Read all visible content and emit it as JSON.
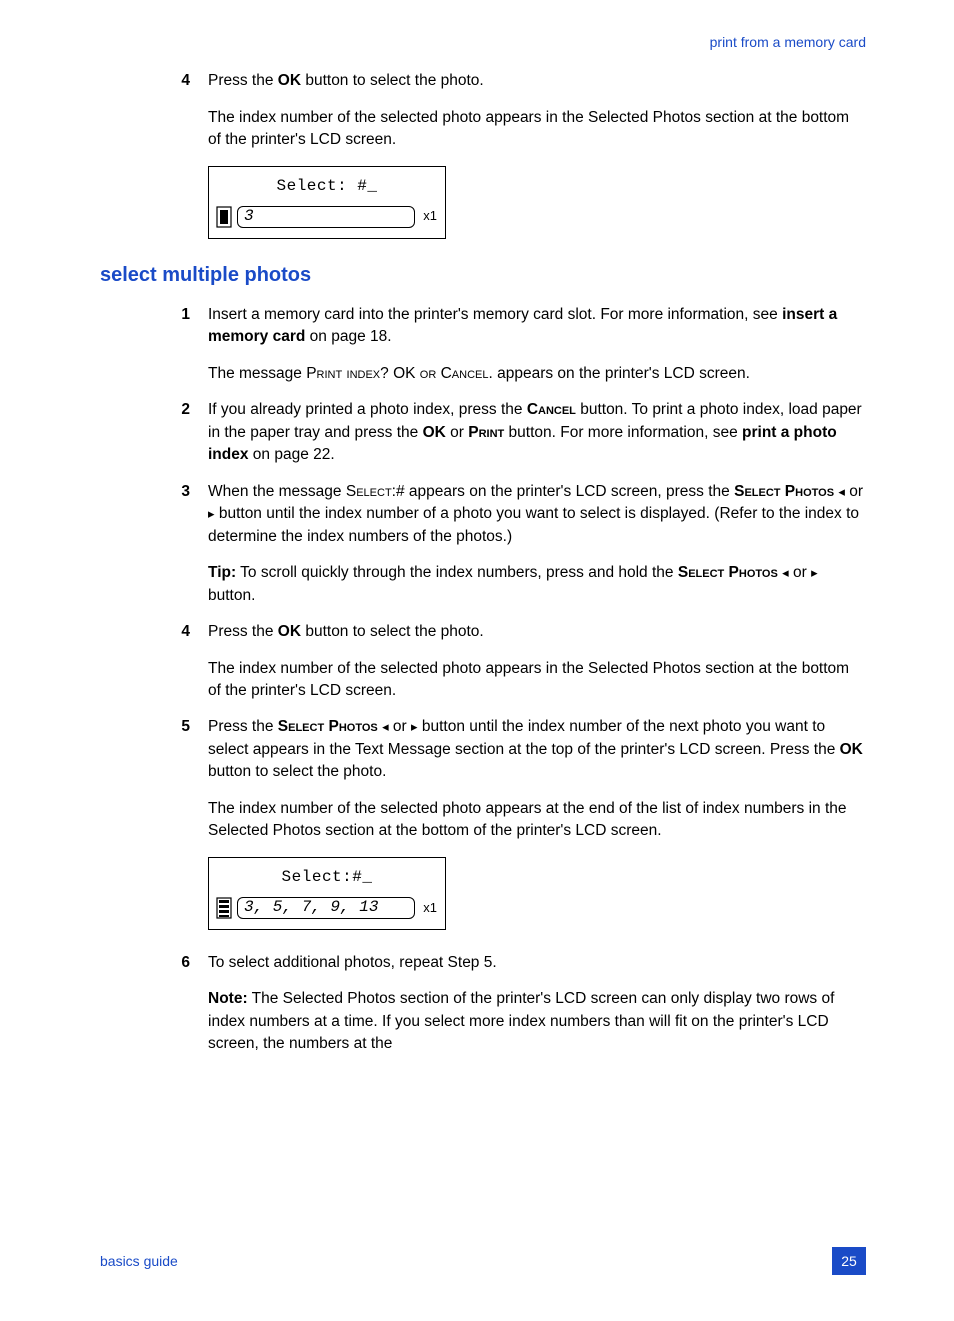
{
  "header": {
    "section": "print from a memory card"
  },
  "pre_steps": [
    {
      "num": "4",
      "paras": [
        "Press the <b>OK</b> button to select the photo.",
        "The index number of the selected photo appears in the Selected Photos section at the bottom of the printer's LCD screen."
      ]
    }
  ],
  "lcd1": {
    "top": "Select: #_",
    "sel": "3",
    "x": "x1"
  },
  "heading": "select multiple photos",
  "steps": [
    {
      "num": "1",
      "paras": [
        "Insert a memory card into the printer's memory card slot. For more information, see <b>insert a memory card</b> on page 18.",
        "The message <span class=\"sc\">Print index</span>? OK <span class=\"sc\">or</span> C<span class=\"sc\">ancel</span>. appears on the printer's LCD screen."
      ]
    },
    {
      "num": "2",
      "paras": [
        "If you already printed a photo index, press the <b>C<span class=\"sc\">ancel</span></b> button. To print a photo index, load paper in the paper tray and press the <b>OK</b> or <b>P<span class=\"sc\">rint</span></b> button. For more information, see <b>print a photo index</b> on page 22."
      ]
    },
    {
      "num": "3",
      "paras": [
        "When the message S<span class=\"sc\">elect</span>:# appears on the printer's LCD screen, press the <b>S<span class=\"sc\">elect</span> P<span class=\"sc\">hotos</span></b> <span class=\"arrow\">◂</span> or <span class=\"arrow\">▸</span> button until the index number of a photo you want to select is displayed. (Refer to the index to determine the index numbers of the photos.)",
        "<b>Tip:</b>   To scroll quickly through the index numbers, press and hold the <b>S<span class=\"sc\">elect</span> P<span class=\"sc\">hotos</span></b> <span class=\"arrow\">◂</span> or <span class=\"arrow\">▸</span> button."
      ]
    },
    {
      "num": "4",
      "paras": [
        "Press the <b>OK</b> button to select the photo.",
        "The index number of the selected photo appears in the Selected Photos section at the bottom of the printer's LCD screen."
      ]
    },
    {
      "num": "5",
      "paras": [
        "Press the <b>S<span class=\"sc\">elect</span> P<span class=\"sc\">hotos</span></b> <span class=\"arrow\">◂</span> or <span class=\"arrow\">▸</span> button until the index number of the next photo you want to select appears in the Text Message section at the top of the printer's LCD screen. Press the <b>OK</b> button to select the photo.",
        "The index number of the selected photo appears at the end of the list of index numbers in the Selected Photos section at the bottom of the printer's LCD screen."
      ]
    }
  ],
  "lcd2": {
    "top": "Select:#_",
    "sel": "3, 5, 7, 9, 13",
    "x": "x1"
  },
  "steps_after": [
    {
      "num": "6",
      "paras": [
        "To select additional photos, repeat Step 5.",
        "<b>Note:</b> The Selected Photos section of the printer's LCD screen can only display two rows of index numbers at a time. If you select more index numbers than will fit on the printer's LCD screen, the numbers at the"
      ]
    }
  ],
  "footer": {
    "left": "basics guide",
    "page": "25"
  }
}
